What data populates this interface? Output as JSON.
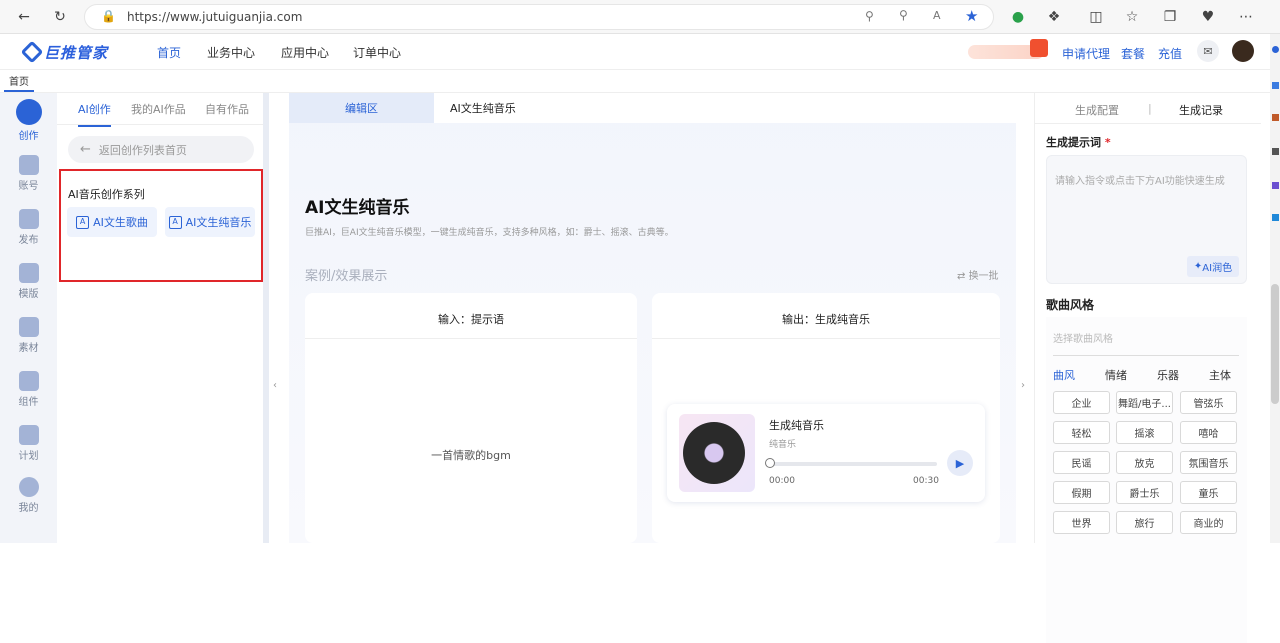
{
  "browser": {
    "url": "https://www.jutuiguanjia.com"
  },
  "appnav": {
    "logo": "巨推管家",
    "items": [
      "首页",
      "业务中心",
      "应用中心",
      "订单中心"
    ],
    "right": [
      "申请代理",
      "套餐",
      "充值"
    ]
  },
  "tabstrip": {
    "tab": "首页"
  },
  "leftnav": [
    "创作",
    "账号",
    "发布",
    "模版",
    "素材",
    "组件",
    "计划",
    "我的"
  ],
  "panel": {
    "tabs": [
      "AI创作",
      "我的AI作品",
      "自有作品"
    ],
    "back": "返回创作列表首页",
    "series_title": "AI音乐创作系列",
    "buttons": [
      "AI文生歌曲",
      "AI文生纯音乐"
    ]
  },
  "main": {
    "tab_edit": "编辑区",
    "tab_title": "AI文生纯音乐",
    "title": "AI文生纯音乐",
    "desc": "巨推AI，巨AI文生纯音乐模型，一键生成纯音乐，支持多种风格，如：爵士、摇滚、古典等。",
    "section": "案例/效果展示",
    "refresh": "换一批",
    "input_label": "输入：提示语",
    "input_text": "一首情歌的bgm",
    "output_label": "输出：生成纯音乐",
    "player_title": "生成纯音乐",
    "player_sub": "纯音乐",
    "time_start": "00:00",
    "time_end": "00:30"
  },
  "right": {
    "tab_config": "生成配置",
    "tab_record": "生成记录",
    "prompt_label": "生成提示词",
    "required": "*",
    "prompt_placeholder": "请输入指令或点击下方AI功能快速生成",
    "ai_polish": "AI润色",
    "style_label": "歌曲风格",
    "style_placeholder": "选择歌曲风格",
    "style_tabs": [
      "曲风",
      "情绪",
      "乐器",
      "主体"
    ],
    "styles": [
      "企业",
      "舞蹈/电子...",
      "管弦乐",
      "轻松",
      "摇滚",
      "嘻哈",
      "民谣",
      "放克",
      "氛围音乐",
      "假期",
      "爵士乐",
      "童乐",
      "世界",
      "旅行",
      "商业的"
    ]
  },
  "colors": {
    "accent": "#2b63d6",
    "highlight": "#e0262a"
  }
}
